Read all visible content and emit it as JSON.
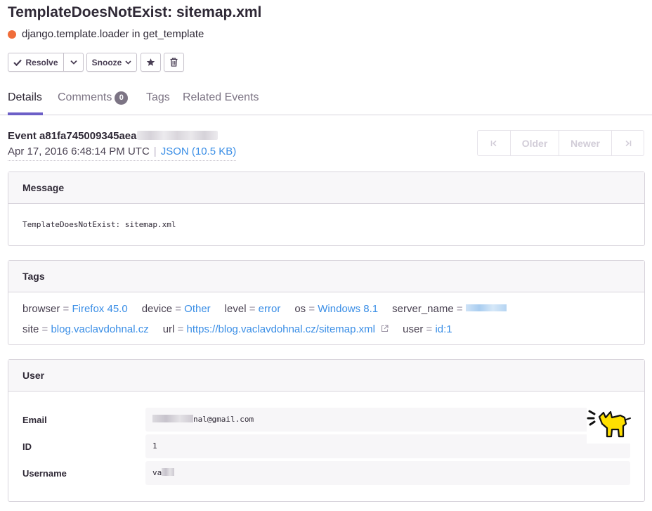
{
  "issue": {
    "title": "TemplateDoesNotExist: sitemap.xml",
    "culprit": "django.template.loader in get_template",
    "level_color": "#f06d3a"
  },
  "actions": {
    "resolve_label": "Resolve",
    "snooze_label": "Snooze",
    "resolve_icon": "checkmark-icon",
    "dropdown_icon": "chevron-down-icon",
    "bookmark_icon": "star-icon",
    "delete_icon": "trash-icon"
  },
  "tabs": [
    {
      "label": "Details",
      "active": true
    },
    {
      "label": "Comments",
      "count": "0"
    },
    {
      "label": "Tags"
    },
    {
      "label": "Related Events"
    }
  ],
  "event": {
    "id_prefix": "Event a81fa745009345aea",
    "timestamp": "Apr 17, 2016 6:48:14 PM UTC",
    "json_link": "JSON (10.5 KB)"
  },
  "pager": {
    "first_icon": "first-page-icon",
    "older_label": "Older",
    "newer_label": "Newer",
    "last_icon": "last-page-icon"
  },
  "message": {
    "header": "Message",
    "text": "TemplateDoesNotExist: sitemap.xml"
  },
  "tags": {
    "header": "Tags",
    "row1": [
      {
        "key": "browser",
        "value": "Firefox 45.0"
      },
      {
        "key": "device",
        "value": "Other"
      },
      {
        "key": "level",
        "value": "error"
      },
      {
        "key": "os",
        "value": "Windows 8.1"
      },
      {
        "key": "server_name",
        "value": ""
      }
    ],
    "row2": [
      {
        "key": "site",
        "value": "blog.vaclavdohnal.cz"
      },
      {
        "key": "url",
        "value": "https://blog.vaclavdohnal.cz/sitemap.xml"
      },
      {
        "key": "user",
        "value": "id:1"
      }
    ],
    "external_link_icon": "external-link-icon"
  },
  "user": {
    "header": "User",
    "email_label": "Email",
    "email_value": "nal@gmail.com",
    "id_label": "ID",
    "id_value": "1",
    "username_label": "Username",
    "username_value": "va"
  },
  "colors": {
    "accent": "#6c5fc7",
    "link": "#3a8ee6",
    "badge": "#7c7484",
    "avatar_yellow": "#ffe000"
  }
}
